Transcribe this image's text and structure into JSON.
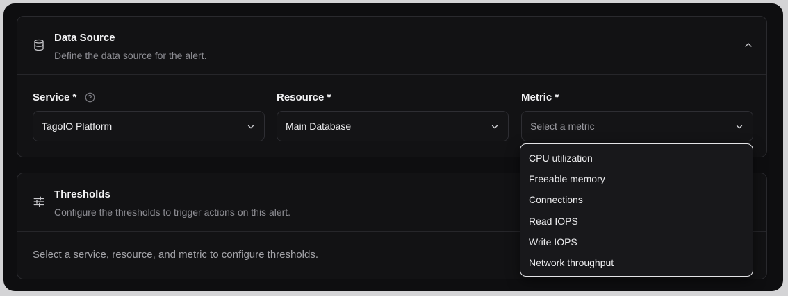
{
  "data_source": {
    "title": "Data Source",
    "description": "Define the data source for the alert.",
    "icon": "database-icon",
    "fields": [
      {
        "label": "Service *",
        "value": "TagoIO Platform"
      },
      {
        "label": "Resource *",
        "value": "Main Database"
      },
      {
        "label": "Metric *",
        "placeholder": "Select a metric"
      }
    ]
  },
  "metric_options": [
    "CPU utilization",
    "Freeable memory",
    "Connections",
    "Read IOPS",
    "Write IOPS",
    "Network throughput"
  ],
  "thresholds": {
    "title": "Thresholds",
    "description": "Configure the thresholds to trigger actions on this alert.",
    "icon": "sliders-icon",
    "empty_message": "Select a service, resource, and metric to configure thresholds."
  }
}
